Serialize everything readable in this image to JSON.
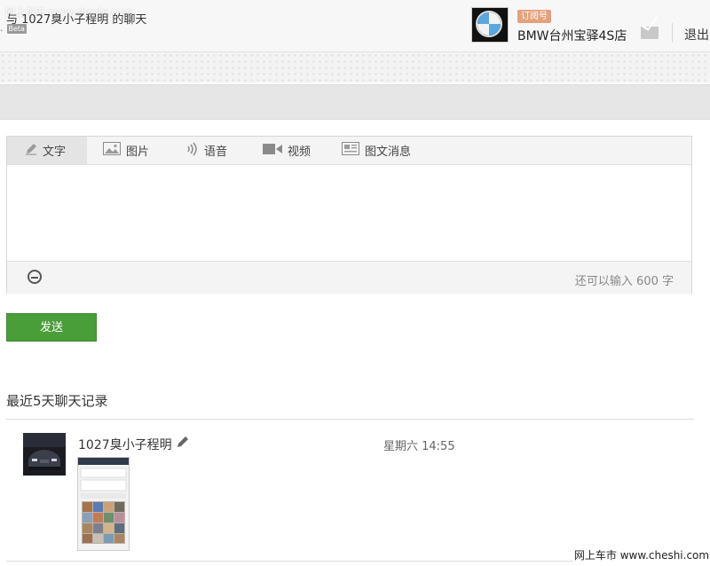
{
  "watermark": {
    "top": "网上车市 www.cheshi.com",
    "bottom": "网上车市 www.cheshi.com"
  },
  "header": {
    "beta_prefix": ".",
    "beta_label": "Beta",
    "account": {
      "avatar_icon": "bmw-logo-icon",
      "badge": "订阅号",
      "badge_color": "#e3a27b",
      "name": "BMW台州宝驿4S店"
    },
    "mail_icon": "mail-icon",
    "logout_label": "退出"
  },
  "chat": {
    "title": "与 1027臭小子程明 的聊天"
  },
  "editor": {
    "tabs": [
      {
        "label": "文字",
        "icon": "pencil-icon",
        "active": true
      },
      {
        "label": "图片",
        "icon": "image-icon",
        "active": false
      },
      {
        "label": "语音",
        "icon": "voice-icon",
        "active": false
      },
      {
        "label": "视频",
        "icon": "video-icon",
        "active": false
      },
      {
        "label": "图文消息",
        "icon": "article-icon",
        "active": false
      }
    ],
    "text_value": "",
    "emoji_icon": "emoji-icon",
    "char_count": "还可以输入 600 字"
  },
  "send_button": {
    "label": "发送",
    "color": "#4a9e39"
  },
  "history": {
    "title": "最近5天聊天记录",
    "messages": [
      {
        "name": "1027臭小子程明",
        "time": "星期六 14:55",
        "content_type": "image"
      }
    ]
  }
}
